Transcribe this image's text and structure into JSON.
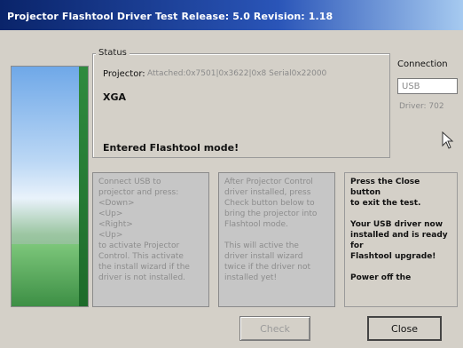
{
  "window": {
    "title": "Projector Flashtool Driver Test   Release: 5.0  Revision: 1.18"
  },
  "status": {
    "legend": "Status",
    "projector_label": "Projector:",
    "projector_value": "Attached:0x7501|0x3622|0x8 Serial0x22000",
    "resolution": "XGA",
    "message": "Entered Flashtool mode!"
  },
  "connection": {
    "label": "Connection",
    "value": "USB",
    "driver": "Driver: 702"
  },
  "panels": {
    "left_lines": [
      "Connect USB to",
      "projector and press:",
      "<Down>",
      "<Up>",
      "<Right>",
      "<Up>",
      "to activate Projector",
      "Control. This activate",
      "the install wizard if the",
      "driver is not installed."
    ],
    "middle_lines": [
      "After Projector Control",
      "driver installed, press",
      "Check button below to",
      "bring the projector into",
      "Flashtool mode.",
      "",
      "This will active the",
      "driver install wizard",
      "twice if the driver not",
      "installed yet!"
    ],
    "right_lines": [
      "Press the Close",
      "button",
      "to exit the test.",
      "",
      "Your USB driver now",
      "installed and is ready",
      "for",
      "Flashtool upgrade!",
      "",
      "Power off the"
    ]
  },
  "buttons": {
    "check": "Check",
    "close": "Close"
  }
}
